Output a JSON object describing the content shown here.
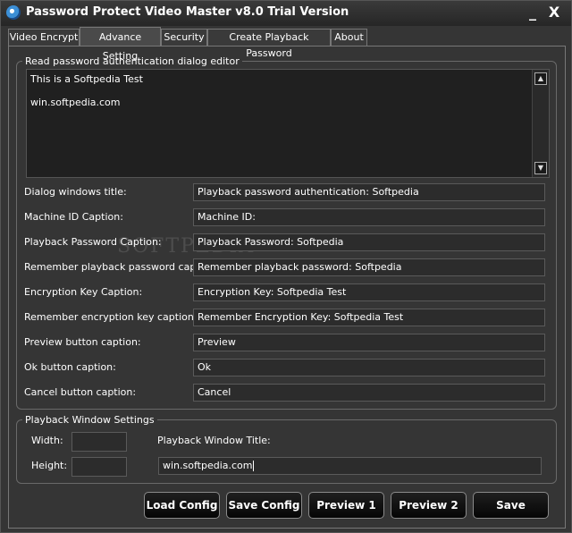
{
  "window": {
    "title": "Password Protect Video Master v8.0 Trial Version",
    "minimize": "_",
    "close": "X"
  },
  "tabs": [
    {
      "label": "Video Encrypt",
      "active": false
    },
    {
      "label": "Advance Setting",
      "active": true
    },
    {
      "label": "Security",
      "active": false
    },
    {
      "label": "Create Playback Password",
      "active": false
    },
    {
      "label": "About",
      "active": false
    }
  ],
  "editor_group": {
    "legend": "Read password authentication dialog editor",
    "lines": [
      "This is a Softpedia Test",
      "",
      "win.softpedia.com"
    ]
  },
  "captions": [
    {
      "label": "Dialog windows title:",
      "value": "Playback password authentication: Softpedia"
    },
    {
      "label": "Machine ID Caption:",
      "value": "Machine ID:"
    },
    {
      "label": "Playback Password Caption:",
      "value": "Playback Password: Softpedia"
    },
    {
      "label": "Remember playback password caption:",
      "value": "Remember playback password: Softpedia"
    },
    {
      "label": "Encryption Key Caption:",
      "value": "Encryption Key: Softpedia Test"
    },
    {
      "label": "Remember encryption key caption:",
      "value": "Remember Encryption Key: Softpedia Test"
    },
    {
      "label": "Preview button caption:",
      "value": "Preview"
    },
    {
      "label": "Ok button caption:",
      "value": "Ok"
    },
    {
      "label": "Cancel button caption:",
      "value": "Cancel"
    }
  ],
  "playback_group": {
    "legend": "Playback Window Settings",
    "width_label": "Width:",
    "width_value": "",
    "height_label": "Height:",
    "height_value": "",
    "title_label": "Playback Window Title:",
    "title_value": "win.softpedia.com"
  },
  "buttons": {
    "load_config": "Load Config",
    "save_config": "Save Config",
    "preview1": "Preview 1",
    "preview2": "Preview 2",
    "save": "Save"
  },
  "watermark": "SOFTPEDIA"
}
